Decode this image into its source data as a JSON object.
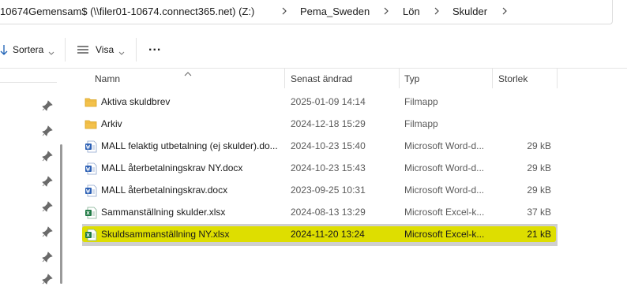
{
  "address": {
    "crumbs": [
      "10674Gemensam$ (\\\\filer01-10674.connect365.net) (Z:)",
      "Pema_Sweden",
      "Lön",
      "Skulder"
    ]
  },
  "toolbar": {
    "sort_label": "Sortera",
    "view_label": "Visa",
    "more_label": "..."
  },
  "columns": {
    "name": "Namn",
    "modified": "Senast ändrad",
    "type": "Typ",
    "size": "Storlek"
  },
  "files": [
    {
      "icon": "folder-icon",
      "name": "Aktiva skuldbrev",
      "modified": "2025-01-09 14:14",
      "type": "Filmapp",
      "size": ""
    },
    {
      "icon": "folder-icon",
      "name": "Arkiv",
      "modified": "2024-12-18 15:29",
      "type": "Filmapp",
      "size": ""
    },
    {
      "icon": "word-doc-icon",
      "name": "MALL felaktig utbetalning (ej skulder).do...",
      "modified": "2024-10-23 15:40",
      "type": "Microsoft Word-d...",
      "size": "29 kB"
    },
    {
      "icon": "word-doc-icon",
      "name": "MALL återbetalningskrav NY.docx",
      "modified": "2024-10-23 15:43",
      "type": "Microsoft Word-d...",
      "size": "29 kB"
    },
    {
      "icon": "word-doc-icon",
      "name": "MALL återbetalningskrav.docx",
      "modified": "2023-09-25 10:31",
      "type": "Microsoft Word-d...",
      "size": "29 kB"
    },
    {
      "icon": "excel-sheet-icon",
      "name": "Sammanställning skulder.xlsx",
      "modified": "2024-08-13 13:29",
      "type": "Microsoft Excel-k...",
      "size": "37 kB"
    },
    {
      "icon": "excel-sheet-icon",
      "name": "Skuldsammanställning NY.xlsx",
      "modified": "2024-11-20 13:24",
      "type": "Microsoft Excel-k...",
      "size": "21 kB"
    }
  ],
  "colors": {
    "highlight": "#dede00",
    "selection": "#cfcfcf",
    "folder": "#f3c14b",
    "word": "#2b5fb4",
    "excel": "#1f7a44"
  }
}
